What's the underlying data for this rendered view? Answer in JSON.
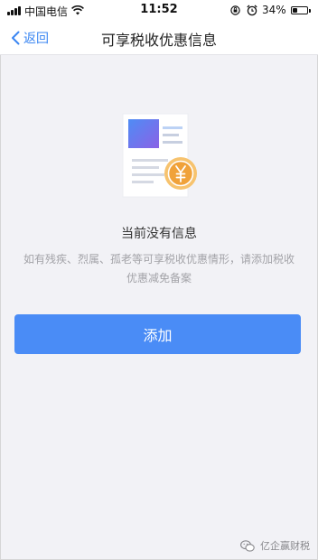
{
  "status_bar": {
    "carrier": "中国电信",
    "time": "11:52",
    "battery_percent": "34%",
    "battery_level": 0.34,
    "icons": [
      "signal-icon",
      "wifi-icon",
      "rotation-lock-icon",
      "alarm-icon",
      "battery-icon"
    ]
  },
  "nav": {
    "back_label": "返回",
    "title": "可享税收优惠信息"
  },
  "empty_state": {
    "title": "当前没有信息",
    "description": "如有残疾、烈属、孤老等可享税收优惠情形，请添加税收优惠减免备案",
    "illustration": "document-yuan-icon"
  },
  "actions": {
    "add_label": "添加"
  },
  "watermark": {
    "text": "亿企赢财税",
    "icon": "wechat-icon"
  },
  "colors": {
    "accent": "#4a8cf6",
    "nav_link": "#3a86f2",
    "background": "#f2f2f6",
    "coin": "#f0a23a"
  }
}
